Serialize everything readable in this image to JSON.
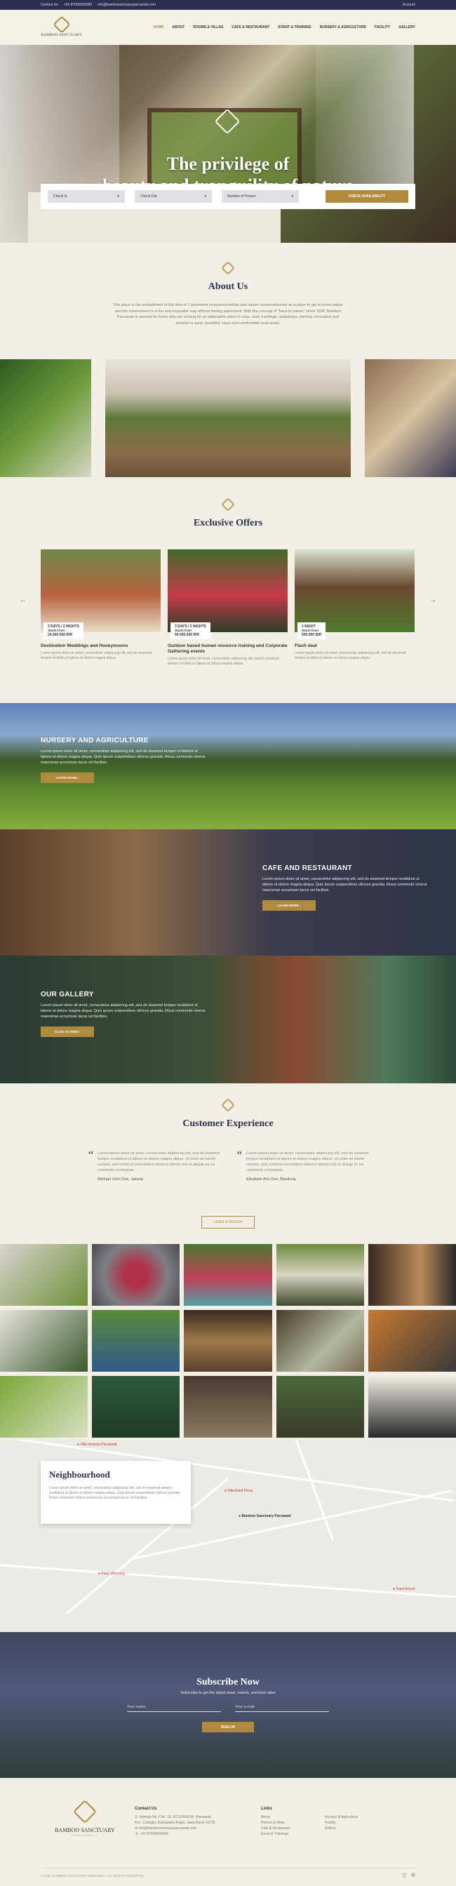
{
  "topbar": {
    "contact_label": "Contact Us",
    "phone": "+62 87000000000",
    "email": "info@bambooanctuaryparcawati.com",
    "account": "Account"
  },
  "brand": {
    "name": "BAMBOO SANCTUARY",
    "sub": "PARCAWATI"
  },
  "nav": [
    "HOME",
    "ABOUT",
    "ROOMS & VILLAS",
    "CAFE & RESTAURANT",
    "EVENT & TRAINING",
    "NURSERY & AGRICULTURE",
    "FACILITY",
    "GALLERY"
  ],
  "hero": {
    "title_1": "The privilege of",
    "title_2": "beauty and tranquility of nature"
  },
  "booking": {
    "check_in": "Check In",
    "check_out": "Check Out",
    "persons": "Number of Person",
    "button": "CHECK AVAILABILITY"
  },
  "about": {
    "title": "About Us",
    "text": "This place is the embodiment of the idea of 7 prominent environmentalists and nature conservationists as a place to get to know nature and the environment in a fun and enjoyable way without feeling patronized. With the concept of \"back to nature\" since 1999, Bamboo Parcawati is opened for those who are looking for an alternative place to relax, work meetings, workshops, training, recreation and worship to quiet, beautiful, clean and comfortable rural areas."
  },
  "offers": {
    "title": "Exclusive Offers",
    "cards": [
      {
        "tag_1": "3 DAYS / 2 NIGHTS",
        "tag_2": "Starts from",
        "price": "24.000.000 IDR",
        "title": "Destination Weddings and Honeymoons",
        "desc": "Lorem ipsum dolor sit amet, consectetur adipiscing elit, sed do eiusmod tempor incididu ut labore et dolore magna aliqua."
      },
      {
        "tag_1": "3 DAYS / 2 NIGHTS",
        "tag_2": "Starts from",
        "price": "50.000.000 IDR",
        "title": "Outdoor based human resource training and Corporate Gathering events",
        "desc": "Lorem ipsum dolor sit amet, consectetur adipiscing elit, sed do eiusmod tempor incididu ut labore et dolore magna aliqua."
      },
      {
        "tag_1": "1 NIGHT",
        "tag_2": "Starts from",
        "price": "500.000 IDR",
        "title": "Flash deal",
        "desc": "Lorem ipsum dolor sit amet, consectetur adipiscing elit, sed do eiusmod tempor incididu ut labore et dolore magna aliqua."
      }
    ]
  },
  "bands": [
    {
      "title": "NURSERY AND AGRICULTURE",
      "text": "Lorem ipsum dolor sit amet, consectetur adipiscing elit, sed do eiusmod tempor incididunt ut labore et dolore magna aliqua. Quis ipsum suspendisse ultrices gravida. Risus commodo viverra maecenas accumsan lacus vel facilisis.",
      "button": "LEARN MORE"
    },
    {
      "title": "CAFE AND RESTAURANT",
      "text": "Lorem ipsum dolor sit amet, consectetur adipiscing elit, sed do eiusmod tempor incididunt ut labore et dolore magna aliqua. Quis ipsum suspendisse ultrices gravida. Risus commodo viverra maecenas accumsan lacus vel facilisis.",
      "button": "LEARN MORE"
    },
    {
      "title": "OUR GALLERY",
      "text": "Lorem ipsum dolor sit amet, consectetur adipiscing elit, sed do eiusmod tempor incididunt ut labore et dolore magna aliqua. Quis ipsum suspendisse ultrices gravida. Risus commodo viverra maecenas accumsan lacus vel facilisis.",
      "button": "CLICK TO VIEW"
    }
  ],
  "cx": {
    "title": "Customer Experience",
    "quotes": [
      {
        "text": "Lorem ipsum dolor sit amet, consectetur adipiscing elit, sed do eiusmod tempor incididunt ut labore et dolore magna aliqua. Ut enim ad minim veniam, quis nostrud exercitation ullamco laboris nisi ut aliquip ex ea commodo consequat.",
        "author": "Michael John Doe, Jakarta"
      },
      {
        "text": "Lorem ipsum dolor sit amet, consectetur adipiscing elit, sed do eiusmod tempor incididunt ut labore et dolore magna aliqua. Ut enim ad minim veniam, quis nostrud exercitation ullamco laboris nisi ut aliquip ex ea commodo consequat.",
        "author": "Elizabeth Ann Doe, Bandung"
      }
    ],
    "button": "LEAVE A REVIEW"
  },
  "neighbourhood": {
    "title": "Neighbourhood",
    "text": "Lorem ipsum dolor sit amet, consectetur adipiscing elit, sed do eiusmod tempor incididunt ut labore et dolore magna aliqua. Quis ipsum suspendisse ultrices gravida. Risus commodo viverra maecenas accumsan lacus vel facilisis.",
    "places": [
      "Villa Venezia Parcawati",
      "Pasir Muncang",
      "Bamboo Sanctuary Parcawati",
      "Villa Bukit Pinus",
      "Tiara Resort"
    ]
  },
  "subscribe": {
    "title": "Subscribe Now",
    "text": "Subscribe to get the latest news, events, and best rates",
    "name": "Your name",
    "email": "Your e-mail",
    "button": "SIGN UP"
  },
  "footer": {
    "contact_title": "Contact Us",
    "address_1": "Jl. Veteran No.1 No. 16, RT.02/RW.04, Parcawati,",
    "address_2": "Kec. Caringin, Kabupaten Bogor, Jawa Barat 16730",
    "email": "info@bambooanctuaryparcawati.com",
    "phone": "+62 87000000000",
    "links_title": "Links",
    "links_a": [
      "About",
      "Rooms & Villas",
      "Cafe & Restaurant",
      "Event & Trainings"
    ],
    "links_b": [
      "Nursery & Agriculture",
      "Facility",
      "Gallery"
    ],
    "copyright": "© 2020, BAMBOO SANCTUARY PARCAWATI. ALL RIGHTS RESERVED."
  }
}
